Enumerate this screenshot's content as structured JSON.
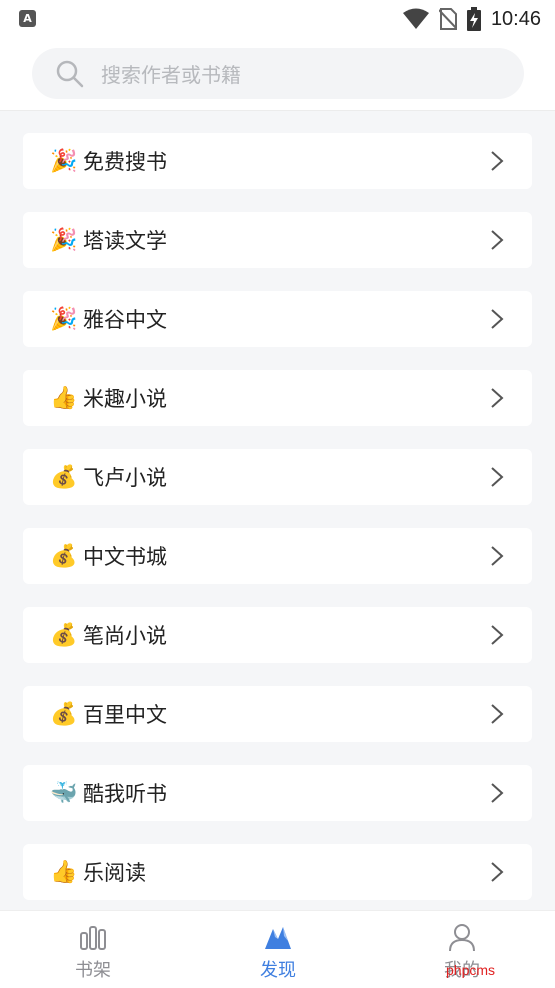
{
  "status_bar": {
    "time": "10:46",
    "app_icon_letter": "A"
  },
  "search": {
    "placeholder": "搜索作者或书籍"
  },
  "list": {
    "items": [
      {
        "icon": "party-popper-icon",
        "emoji": "🎉",
        "label": "免费搜书"
      },
      {
        "icon": "party-popper-icon",
        "emoji": "🎉",
        "label": "塔读文学"
      },
      {
        "icon": "party-popper-icon",
        "emoji": "🎉",
        "label": "雅谷中文"
      },
      {
        "icon": "thumbs-up-icon",
        "emoji": "👍",
        "label": "米趣小说"
      },
      {
        "icon": "money-bag-icon",
        "emoji": "💰",
        "label": "飞卢小说"
      },
      {
        "icon": "money-bag-icon",
        "emoji": "💰",
        "label": "中文书城"
      },
      {
        "icon": "money-bag-icon",
        "emoji": "💰",
        "label": "笔尚小说"
      },
      {
        "icon": "money-bag-icon",
        "emoji": "💰",
        "label": "百里中文"
      },
      {
        "icon": "whale-icon",
        "emoji": "🐳",
        "label": "酷我听书"
      },
      {
        "icon": "thumbs-up-icon",
        "emoji": "👍",
        "label": "乐阅读"
      }
    ]
  },
  "tabbar": {
    "tabs": [
      {
        "label": "书架",
        "icon": "bookshelf-icon",
        "active": false
      },
      {
        "label": "发现",
        "icon": "discover-icon",
        "active": true
      },
      {
        "label": "我的",
        "icon": "profile-icon",
        "active": false
      }
    ]
  },
  "watermark": "phpcms",
  "colors": {
    "accent": "#3f7fe0",
    "background": "#f5f6f8",
    "tab_inactive": "#8e8e93"
  }
}
